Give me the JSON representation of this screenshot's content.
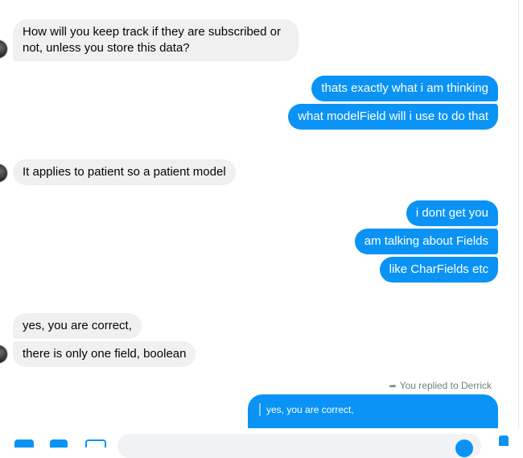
{
  "messages": [
    {
      "side": "in",
      "text": "How will you keep track if they are subscribed or not, unless you store this data?"
    },
    {
      "side": "out",
      "text": "thats exactly what i am thinking"
    },
    {
      "side": "out",
      "text": "what modelField will i use to do that"
    },
    {
      "side": "in",
      "text": "It applies to patient so a patient model"
    },
    {
      "side": "out",
      "text": "i dont get you"
    },
    {
      "side": "out",
      "text": "am talking about Fields"
    },
    {
      "side": "out",
      "text": "like CharFields etc"
    },
    {
      "side": "in",
      "text": "yes, you are correct,"
    },
    {
      "side": "in",
      "text": "there is only one field, boolean"
    }
  ],
  "reply": {
    "label": "You replied to Derrick",
    "quoted_text": "yes, you are correct,"
  },
  "colors": {
    "outgoing_bubble": "#0a93f5",
    "incoming_bubble": "#f0f0f0"
  },
  "composer": {
    "icons": [
      "media-icon",
      "gif-icon",
      "sticker-icon",
      "emoji-icon",
      "like-icon"
    ]
  }
}
